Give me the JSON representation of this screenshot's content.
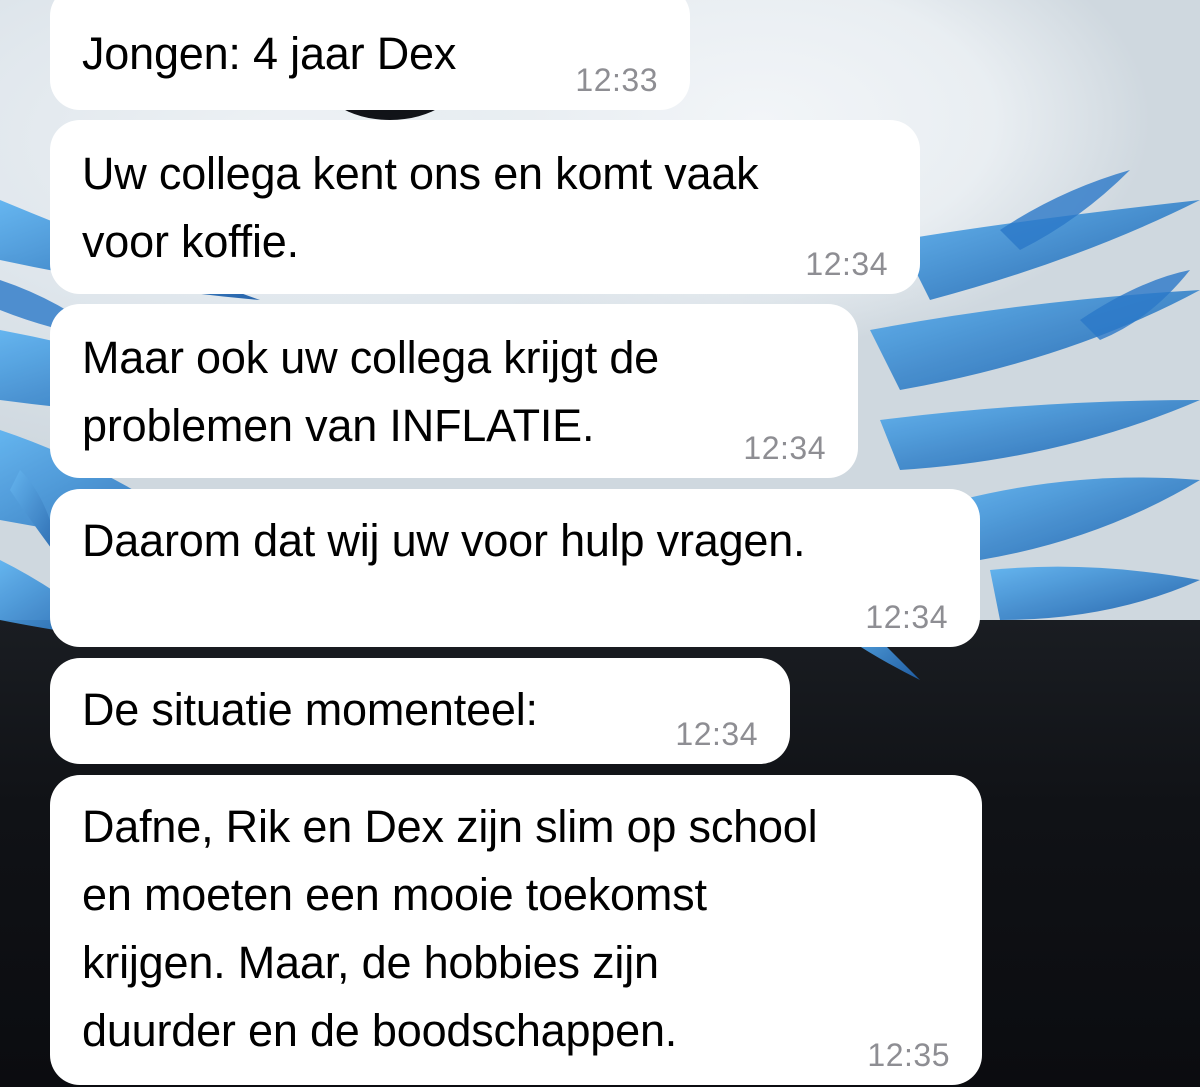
{
  "messages": [
    {
      "text": "Jongen: 4 jaar Dex",
      "time": "12:33"
    },
    {
      "text": "Uw collega kent ons en komt vaak\nvoor koffie.",
      "time": "12:34"
    },
    {
      "text": "Maar ook uw collega krijgt de\nproblemen van INFLATIE.",
      "time": "12:34"
    },
    {
      "text": "Daarom dat wij uw voor hulp vragen.",
      "time": "12:34"
    },
    {
      "text": "De situatie momenteel:",
      "time": "12:34"
    },
    {
      "text": "Dafne, Rik en Dex zijn slim op school\nen moeten een mooie toekomst\nkrijgen. Maar, de hobbies zijn\nduurder en de boodschappen.",
      "time": "12:35"
    }
  ],
  "colors": {
    "bubble": "#ffffff",
    "timestamp": "#8e8e93",
    "wallpaper_accent": "#3b8fd9"
  }
}
